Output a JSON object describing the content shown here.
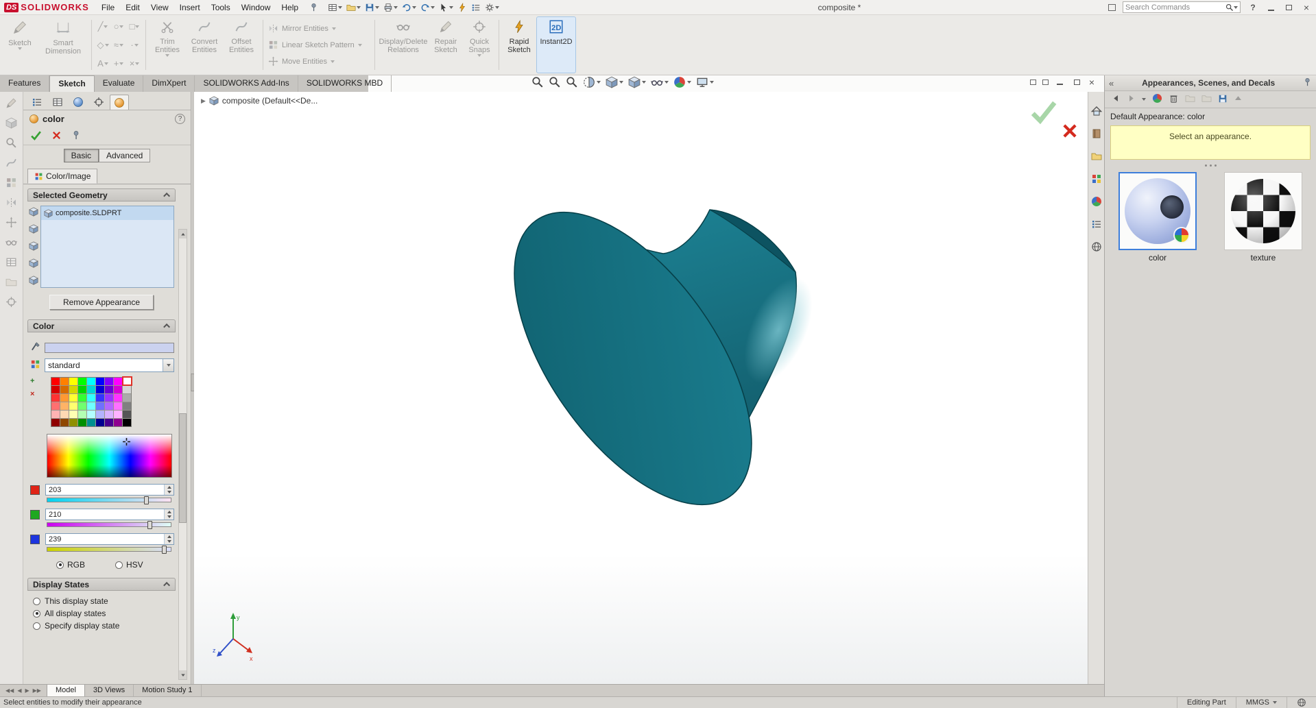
{
  "window": {
    "logo_prefix": "DS",
    "logo": "SOLIDWORKS",
    "title": "composite *",
    "search_placeholder": "Search Commands",
    "help": "?"
  },
  "menubar": {
    "items": [
      "File",
      "Edit",
      "View",
      "Insert",
      "Tools",
      "Window",
      "Help"
    ]
  },
  "command_tabs": {
    "items": [
      {
        "label": "Features"
      },
      {
        "label": "Sketch",
        "active": true
      },
      {
        "label": "Evaluate"
      },
      {
        "label": "DimXpert"
      },
      {
        "label": "SOLIDWORKS Add-Ins"
      },
      {
        "label": "SOLIDWORKS MBD"
      }
    ]
  },
  "ribbon": {
    "sketch": "Sketch",
    "smart_dimension": "Smart Dimension",
    "mini_glyphs": [
      "╱",
      "○",
      "□",
      "◇",
      "≈",
      "·",
      "A",
      "+",
      "×"
    ],
    "trim": "Trim Entities",
    "convert": "Convert Entities",
    "offset": "Offset Entities",
    "mirror": "Mirror Entities",
    "linear_pattern": "Linear Sketch Pattern",
    "move": "Move Entities",
    "display_delete": "Display/Delete Relations",
    "repair": "Repair Sketch",
    "quick_snaps": "Quick Snaps",
    "rapid_sketch": "Rapid Sketch",
    "instant2d": "Instant2D"
  },
  "viewport": {
    "breadcrumb": "composite  (Default<<De..."
  },
  "property_manager": {
    "title": "color",
    "help": "?",
    "modes": [
      {
        "label": "Basic",
        "active": true
      },
      {
        "label": "Advanced"
      }
    ],
    "color_image_tab": "Color/Image",
    "selected_geometry": {
      "title": "Selected Geometry",
      "item": "composite.SLDPRT",
      "remove_button": "Remove Appearance"
    },
    "color_group": {
      "title": "Color",
      "dropdown_value": "standard",
      "preview_hex": "#CBD2EF",
      "palette": [
        "#ff0000",
        "#ff8000",
        "#ffff00",
        "#00ff00",
        "#00ffff",
        "#0000ff",
        "#8000ff",
        "#ff00ff",
        "#ffffff",
        "#d60000",
        "#d66b00",
        "#d6d600",
        "#00d600",
        "#00d6d6",
        "#0000d6",
        "#6b00d6",
        "#d600d6",
        "#d6d6d6",
        "#ff3333",
        "#ff9933",
        "#ffff33",
        "#33ff33",
        "#33ffff",
        "#3333ff",
        "#9933ff",
        "#ff33ff",
        "#ababab",
        "#ff7070",
        "#ffb366",
        "#ffff70",
        "#70ff70",
        "#70ffff",
        "#7070ff",
        "#b366ff",
        "#ff70ff",
        "#808080",
        "#ffb3b3",
        "#ffd9b3",
        "#ffffb3",
        "#b3ffb3",
        "#b3ffff",
        "#b3b3ff",
        "#d9b3ff",
        "#ffb3ff",
        "#555555",
        "#8f0000",
        "#8f4700",
        "#8f8f00",
        "#008f00",
        "#008f8f",
        "#00008f",
        "#47008f",
        "#8f008f",
        "#000000"
      ],
      "channels": [
        {
          "name": "R",
          "value": "203",
          "chip": "#e02417"
        },
        {
          "name": "G",
          "value": "210",
          "chip": "#1fa81f"
        },
        {
          "name": "B",
          "value": "239",
          "chip": "#1d35df"
        }
      ],
      "radio_rgb": "RGB",
      "radio_hsv": "HSV"
    },
    "display_states": {
      "title": "Display States",
      "options": [
        {
          "label": "This display state"
        },
        {
          "label": "All display states",
          "selected": true
        },
        {
          "label": "Specify display state"
        }
      ]
    }
  },
  "task_pane": {
    "title": "Appearances, Scenes, and Decals",
    "default_appearance": "Default Appearance: color",
    "message": "Select an appearance.",
    "thumbnails": [
      {
        "label": "color",
        "selected": true
      },
      {
        "label": "texture"
      }
    ]
  },
  "bottom_tabs": {
    "items": [
      {
        "label": "Model",
        "active": true
      },
      {
        "label": "3D Views"
      },
      {
        "label": "Motion Study 1"
      }
    ]
  },
  "status_bar": {
    "message": "Select entities to modify their appearance",
    "mode": "Editing Part",
    "units": "MMGS"
  },
  "colors": {
    "model_teal": "#1a7b8c",
    "model_dark": "#0d5361",
    "selection_blue": "#3d7edb",
    "message_yellow": "#ffffc4"
  }
}
